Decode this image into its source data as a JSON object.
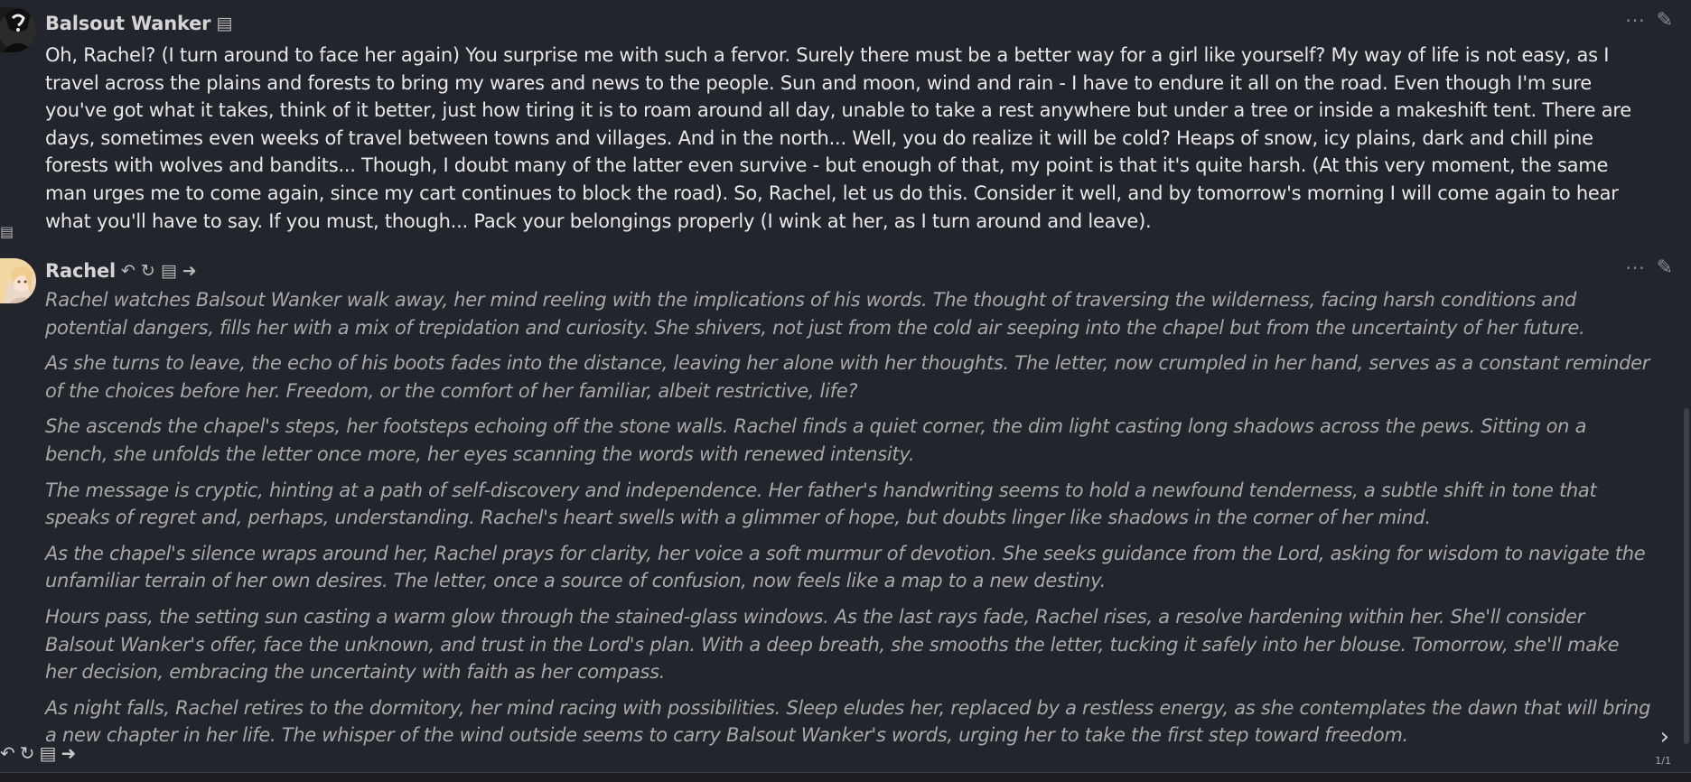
{
  "messages": [
    {
      "name": "Balsout Wanker",
      "name_icons": [
        "▤"
      ],
      "text": "Oh, Rachel? (I turn around to face her again) You surprise me with such a fervor. Surely there must be a better way for a girl like yourself? My way of life is not easy, as I travel across the plains and forests to bring my wares and news to the people. Sun and moon, wind and rain - I have to endure it all on the road. Even though I'm sure you've got what it takes, think of it better, just how tiring it is to roam around all day, unable to take a rest anywhere but under a tree or inside a makeshift tent. There are days, sometimes even weeks of travel between towns and villages. And in the north... Well, you do realize it will be cold? Heaps of snow, icy plains, dark and chill pine forests with wolves and bandits... Though, I doubt many of the latter even survive - but enough of that, my point is that it's quite harsh. (At this very moment, the same man urges me to come again, since my cart continues to block the road). So, Rachel, let us do this. Consider it well, and by tomorrow's morning I will come again to hear what you'll have to say. If you must, though... Pack your belongings properly (I wink at her, as I turn around and leave)."
    },
    {
      "name": "Rachel",
      "name_icons": [
        "↶",
        "↻",
        "▤",
        "➜"
      ],
      "paragraphs": [
        "Rachel watches Balsout Wanker walk away, her mind reeling with the implications of his words. The thought of traversing the wilderness, facing harsh conditions and potential dangers, fills her with a mix of trepidation and curiosity. She shivers, not just from the cold air seeping into the chapel but from the uncertainty of her future.",
        "As she turns to leave, the echo of his boots fades into the distance, leaving her alone with her thoughts. The letter, now crumpled in her hand, serves as a constant reminder of the choices before her. Freedom, or the comfort of her familiar, albeit restrictive, life?",
        "She ascends the chapel's steps, her footsteps echoing off the stone walls. Rachel finds a quiet corner, the dim light casting long shadows across the pews. Sitting on a bench, she unfolds the letter once more, her eyes scanning the words with renewed intensity.",
        "The message is cryptic, hinting at a path of self-discovery and independence. Her father's handwriting seems to hold a newfound tenderness, a subtle shift in tone that speaks of regret and, perhaps, understanding. Rachel's heart swells with a glimmer of hope, but doubts linger like shadows in the corner of her mind.",
        "As the chapel's silence wraps around her, Rachel prays for clarity, her voice a soft murmur of devotion. She seeks guidance from the Lord, asking for wisdom to navigate the unfamiliar terrain of her own desires. The letter, once a source of confusion, now feels like a map to a new destiny.",
        "Hours pass, the setting sun casting a warm glow through the stained-glass windows. As the last rays fade, Rachel rises, a resolve hardening within her. She'll consider Balsout Wanker's offer, face the unknown, and trust in the Lord's plan. With a deep breath, she smooths the letter, tucking it safely into her blouse. Tomorrow, she'll make her decision, embracing the uncertainty with faith as her compass.",
        "As night falls, Rachel retires to the dormitory, her mind racing with possibilities. Sleep eludes her, replaced by a restless energy, as she contemplates the dawn that will bring a new chapter in her life. The whisper of the wind outside seems to carry Balsout Wanker's words, urging her to take the first step toward freedom."
      ]
    }
  ],
  "toolbar": {
    "more_glyph": "···",
    "edit_glyph": "✎"
  },
  "swipe": {
    "left_icons": [
      "↶",
      "↻",
      "▤",
      "➜"
    ],
    "right_arrow": "›",
    "counter": "1/1"
  },
  "stray_icon": "▤"
}
